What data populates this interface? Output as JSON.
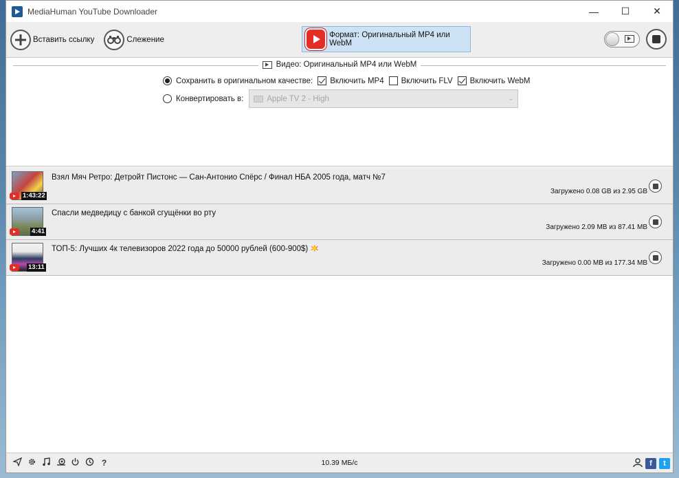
{
  "window": {
    "title": "MediaHuman YouTube Downloader",
    "controls": {
      "minimize": "—",
      "maximize": "☐",
      "close": "✕"
    }
  },
  "toolbar": {
    "paste_link_label": "Вставить ссылку",
    "tracking_label": "Слежение",
    "format_label": "Формат: Оригинальный MP4 или WebM"
  },
  "settings": {
    "section_title": "Видео: Оригинальный MP4 или WebM",
    "save_original_label": "Сохранить в оригинальном качестве:",
    "include_mp4_label": "Включить MP4",
    "include_mp4_checked": true,
    "include_flv_label": "Включить FLV",
    "include_flv_checked": false,
    "include_webm_label": "Включить WebM",
    "include_webm_checked": true,
    "convert_label": "Конвертировать в:",
    "convert_preset": "Apple TV 2 - High",
    "selected_mode": "original"
  },
  "downloads": [
    {
      "title": "Взял Мяч Ретро: Детройт Пистонс — Сан-Антонио Спёрс / Финал НБА 2005 года, матч №7",
      "duration": "1:43:22",
      "status": "Загружено 0.08 GB из 2.95 GB"
    },
    {
      "title": "Спасли медведицу с банкой сгущёнки во рту",
      "duration": "4:41",
      "status": "Загружено 2.09 MB из 87.41 MB"
    },
    {
      "title": "ТОП-5: Лучших 4к телевизоров 2022 года до 50000 рублей (600-900$)",
      "duration": "13:11",
      "status": "Загружено 0.00 MB из 177.34 MB"
    }
  ],
  "statusbar": {
    "speed": "10.39 МБ/с",
    "icons": [
      "send-icon",
      "settings-gear-icon",
      "music-icon",
      "snail-icon",
      "power-icon",
      "clock-icon",
      "help-icon"
    ],
    "help_glyph": "?",
    "facebook_glyph": "f",
    "twitter_glyph": "t"
  },
  "colors": {
    "youtube_red": "#e52d27",
    "format_button_bg": "#cde3f5",
    "row_bg": "#ececec"
  }
}
